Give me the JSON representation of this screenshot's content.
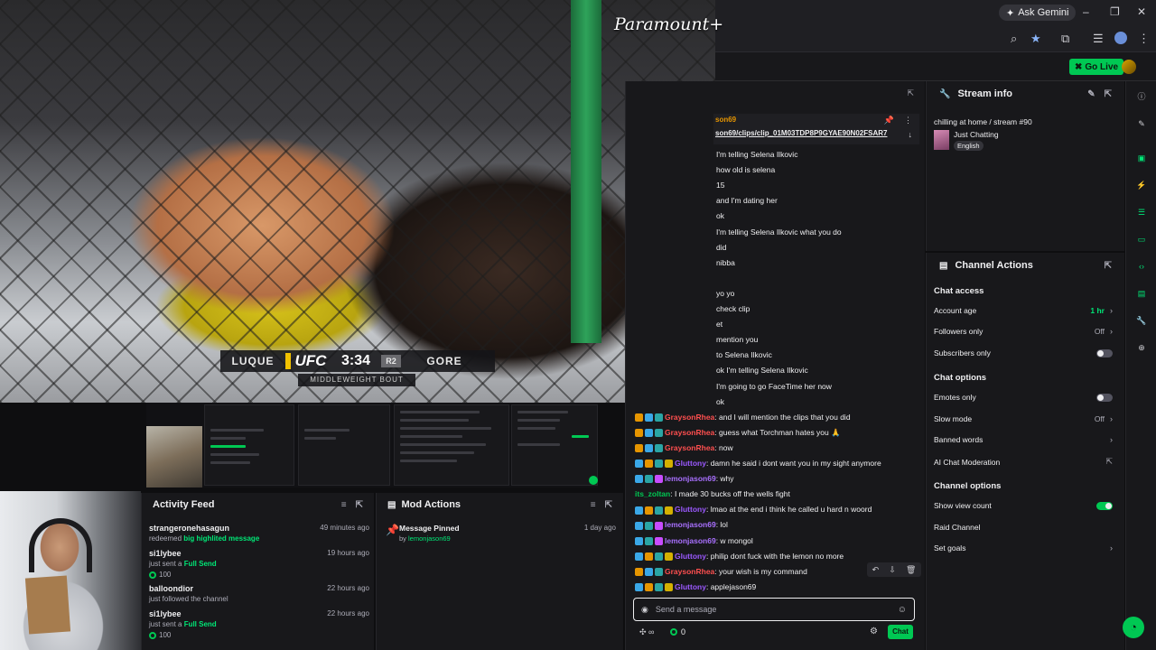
{
  "browser": {
    "ask_gemini": "Ask Gemini"
  },
  "app_header": {
    "go_live": "Go Live"
  },
  "video": {
    "watermark": "Paramount+",
    "fighter_left": "LUQUE",
    "league": "UFC",
    "clock": "3:34",
    "round": "R2",
    "fighter_right": "GORE",
    "bout": "MIDDLEWEIGHT BOUT"
  },
  "activity_feed": {
    "title": "Activity Feed",
    "items": [
      {
        "user": "strangeronehasagun",
        "prefix": "redeemed ",
        "highlight": "big highlited message",
        "time": "49 minutes ago",
        "amount": ""
      },
      {
        "user": "si1lybee",
        "prefix": "just sent a ",
        "highlight": "Full Send",
        "time": "19 hours ago",
        "amount": "100"
      },
      {
        "user": "balloondior",
        "prefix": "just followed the channel",
        "highlight": "",
        "time": "22 hours ago",
        "amount": ""
      },
      {
        "user": "si1lybee",
        "prefix": "just sent a ",
        "highlight": "Full Send",
        "time": "22 hours ago",
        "amount": "100"
      }
    ]
  },
  "mod_actions": {
    "title": "Mod Actions",
    "items": [
      {
        "title": "Message Pinned",
        "by": "by ",
        "user": "lemonjason69",
        "time": "1 day ago"
      }
    ]
  },
  "chat": {
    "pinned": {
      "user": "son69",
      "link": "son69/clips/clip_01M03TDP8P9GYAE90N02FSAR7"
    },
    "messages": [
      {
        "name": "",
        "color": "",
        "text": "I'm telling Selena Ilkovic",
        "badges": []
      },
      {
        "name": "",
        "color": "",
        "text": "how old is selena",
        "badges": []
      },
      {
        "name": "",
        "color": "",
        "text": "15",
        "badges": []
      },
      {
        "name": "",
        "color": "",
        "text": "and I'm dating her",
        "badges": []
      },
      {
        "name": "",
        "color": "",
        "text": "ok",
        "badges": []
      },
      {
        "name": "",
        "color": "",
        "text": "I'm telling Selena Ilkovic what you do",
        "badges": []
      },
      {
        "name": "",
        "color": "",
        "text": "did",
        "badges": []
      },
      {
        "name": "",
        "color": "",
        "text": "nibba",
        "badges": []
      },
      {
        "name": "",
        "color": "",
        "text": "",
        "badges": []
      },
      {
        "name": "",
        "color": "",
        "text": "yo yo",
        "badges": []
      },
      {
        "name": "",
        "color": "",
        "text": "check clip",
        "badges": []
      },
      {
        "name": "",
        "color": "",
        "text": "et",
        "badges": []
      },
      {
        "name": "",
        "color": "",
        "text": "mention you",
        "badges": []
      },
      {
        "name": "",
        "color": "",
        "text": "to Selena Ilkovic",
        "badges": []
      },
      {
        "name": "",
        "color": "",
        "text": "ok I'm telling Selena Ilkovic",
        "badges": []
      },
      {
        "name": "",
        "color": "",
        "text": "I'm going to go FaceTime her now",
        "badges": []
      },
      {
        "name": "",
        "color": "",
        "text": "ok",
        "badges": []
      },
      {
        "name": "GraysonRhea",
        "color": "#ff4f4f",
        "text": "and I will mention the clips that you did",
        "badges": [
          "#e69500",
          "#3aa8e8",
          "#2aa5a5"
        ]
      },
      {
        "name": "GraysonRhea",
        "color": "#ff4f4f",
        "text": "guess what Torchman hates you 🙏",
        "badges": [
          "#e69500",
          "#3aa8e8",
          "#2aa5a5"
        ]
      },
      {
        "name": "GraysonRhea",
        "color": "#ff4f4f",
        "text": "now",
        "badges": [
          "#e69500",
          "#3aa8e8",
          "#2aa5a5"
        ]
      },
      {
        "name": "Gluttony",
        "color": "#9b59ff",
        "text": "damn he said i dont want you in my sight anymore",
        "badges": [
          "#3aa8e8",
          "#e69500",
          "#2aa5a5",
          "#d4b000"
        ]
      },
      {
        "name": "lemonjason69",
        "color": "#a970ff",
        "text": "why",
        "badges": [
          "#3aa8e8",
          "#2aa5a5",
          "#c84cff"
        ]
      },
      {
        "name": "its_zoltan",
        "color": "#00c853",
        "text": "I made 30 bucks off the wells fight",
        "badges": []
      },
      {
        "name": "Gluttony",
        "color": "#9b59ff",
        "text": "lmao at the end i think he called u hard n woord",
        "badges": [
          "#3aa8e8",
          "#e69500",
          "#2aa5a5",
          "#d4b000"
        ]
      },
      {
        "name": "lemonjason69",
        "color": "#a970ff",
        "text": "lol",
        "badges": [
          "#3aa8e8",
          "#2aa5a5",
          "#c84cff"
        ]
      },
      {
        "name": "lemonjason69",
        "color": "#a970ff",
        "text": "w mongol",
        "badges": [
          "#3aa8e8",
          "#2aa5a5",
          "#c84cff"
        ]
      },
      {
        "name": "Gluttony",
        "color": "#9b59ff",
        "text": "philip dont fuck with the lemon no more",
        "badges": [
          "#3aa8e8",
          "#e69500",
          "#2aa5a5",
          "#d4b000"
        ]
      },
      {
        "name": "GraysonRhea",
        "color": "#ff4f4f",
        "text": "your wish is my command",
        "badges": [
          "#e69500",
          "#3aa8e8",
          "#2aa5a5"
        ]
      },
      {
        "name": "Gluttony",
        "color": "#9b59ff",
        "text": "applejason69",
        "badges": [
          "#3aa8e8",
          "#e69500",
          "#2aa5a5",
          "#d4b000"
        ]
      }
    ],
    "input_placeholder": "Send a message",
    "points": "0",
    "send_label": "Chat"
  },
  "stream_info": {
    "title": "Stream info",
    "stream_title": "chilling at home / stream #90",
    "category": "Just Chatting",
    "language": "English"
  },
  "channel_actions": {
    "title": "Channel Actions",
    "sections": [
      {
        "heading": "Chat access",
        "options": [
          {
            "label": "Account age",
            "value": "1 hr",
            "control": "chevron",
            "accent": true
          },
          {
            "label": "Followers only",
            "value": "Off",
            "control": "chevron",
            "accent": false
          },
          {
            "label": "Subscribers only",
            "value": "",
            "control": "toggle-off",
            "accent": false
          }
        ]
      },
      {
        "heading": "Chat options",
        "options": [
          {
            "label": "Emotes only",
            "value": "",
            "control": "toggle-off",
            "accent": false
          },
          {
            "label": "Slow mode",
            "value": "Off",
            "control": "chevron",
            "accent": false
          },
          {
            "label": "Banned words",
            "value": "",
            "control": "chevron",
            "accent": false
          },
          {
            "label": "AI Chat Moderation",
            "value": "",
            "control": "external",
            "accent": false
          }
        ]
      },
      {
        "heading": "Channel options",
        "options": [
          {
            "label": "Show view count",
            "value": "",
            "control": "toggle-on",
            "accent": false
          },
          {
            "label": "Raid Channel",
            "value": "",
            "control": "none",
            "accent": false
          },
          {
            "label": "Set goals",
            "value": "",
            "control": "chevron",
            "accent": false
          }
        ]
      }
    ]
  },
  "colors": {
    "accent": "#00c853",
    "background": "#0e0e10",
    "panel": "#18181b"
  }
}
